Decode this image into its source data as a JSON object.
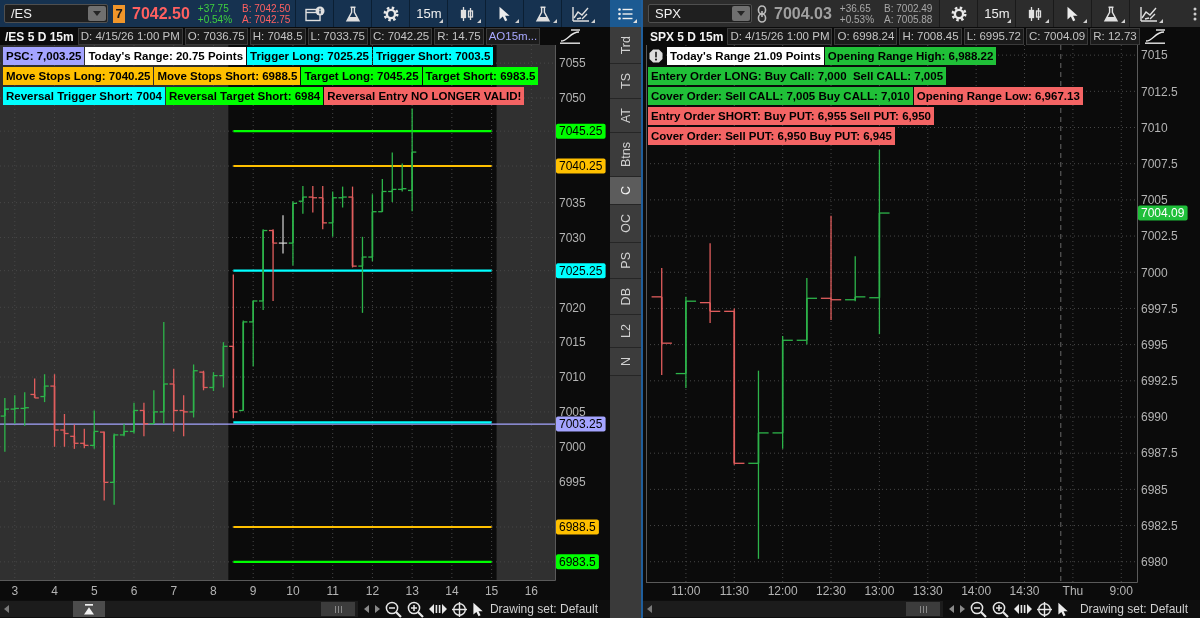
{
  "left_chart": {
    "active": true,
    "symbol": "/ES",
    "link_group": "7",
    "last_price": "7042.50",
    "live": true,
    "down_tick": true,
    "net_change": "+37.75",
    "percent_change": "+0.54%",
    "bid": "B: 7042.50",
    "ask": "A: 7042.75",
    "aggregation": "15m",
    "title": "/ES 5 D 15m",
    "info": [
      {
        "text": "D: 4/15/26 1:00 PM",
        "kind": "value"
      },
      {
        "text": "O: 7036.75",
        "kind": "value"
      },
      {
        "text": "H: 7048.5",
        "kind": "value"
      },
      {
        "text": "L: 7033.75",
        "kind": "value"
      },
      {
        "text": "C: 7042.25",
        "kind": "value"
      },
      {
        "text": "R: 14.75",
        "kind": "value"
      },
      {
        "text": "AO15m...",
        "kind": "study"
      }
    ],
    "label_rows": [
      [
        {
          "text": "PSC: 7,003.25",
          "color": "#a4a4ff"
        },
        {
          "text": "Today's Range: 20.75 Points",
          "color": "#ffffff"
        },
        {
          "text": "Trigger Long: 7025.25",
          "color": "#00ffff"
        },
        {
          "text": "Trigger Short: 7003.5",
          "color": "#00ffff"
        }
      ],
      [
        {
          "text": "Move Stops Long: 7040.25",
          "color": "#ffc000"
        },
        {
          "text": "Move Stops Short: 6988.5",
          "color": "#ffc000"
        },
        {
          "text": "Target Long: 7045.25",
          "color": "#00ff00"
        },
        {
          "text": "Target Short: 6983.5",
          "color": "#00ff00"
        }
      ],
      [
        {
          "text": "Reversal Trigger Short: 7004",
          "color": "#00ffff"
        },
        {
          "text": "Reversal Target Short: 6984",
          "color": "#00ff00"
        },
        {
          "text": "Reversal Entry NO LONGER VALID!",
          "color": "#f46464"
        }
      ]
    ],
    "chart_data": [
      {
        "type": "candlestick",
        "x": [
          2.75,
          3,
          3.25,
          3.5,
          3.75,
          4,
          4.25,
          4.5,
          4.75,
          5,
          5.25,
          5.5,
          5.75,
          6,
          6.25,
          6.5,
          6.75,
          7,
          7.25,
          7.5,
          7.75,
          8,
          8.25,
          8.5,
          8.75,
          9,
          9.25,
          9.5,
          9.75,
          10,
          10.25,
          10.5,
          10.75,
          11,
          11.25,
          11.5,
          11.75,
          12,
          12.25,
          12.5,
          12.75,
          13,
          13.25,
          13.5,
          13.75,
          14,
          14.25,
          14.5,
          14.75,
          15
        ],
        "ohlc": [
          [
            7004.4,
            7007,
            6999.3,
            7005.4
          ],
          [
            7005.4,
            7007.4,
            7003.3,
            7005.5
          ],
          [
            7005.5,
            7007.8,
            7003,
            7005.6
          ],
          [
            7007.5,
            7009.8,
            7007,
            7007
          ],
          [
            7007.2,
            7010.4,
            7006.4,
            7008.7
          ],
          [
            7008.7,
            7010.4,
            7000,
            7002.4
          ],
          [
            7002.4,
            7004.7,
            7000,
            7001.9
          ],
          [
            7001.5,
            7003.2,
            6999.7,
            7000.5
          ],
          [
            7000.5,
            7002.6,
            6999.8,
            7000.2
          ],
          [
            7000.2,
            7005.2,
            6999.7,
            7002.2
          ],
          [
            7002.1,
            7002.2,
            6992.3,
            6994.9
          ],
          [
            6994.9,
            7001.9,
            6991.7,
            7001.7
          ],
          [
            7001.7,
            7003.3,
            7001.5,
            7002.2
          ],
          [
            7002.2,
            7006.3,
            7001.9,
            7005.2
          ],
          [
            7005.2,
            7006.3,
            7001.5,
            7003.3
          ],
          [
            7003.3,
            7008.1,
            7003.3,
            7005
          ],
          [
            7005,
            7017.9,
            7003.3,
            7009
          ],
          [
            7009,
            7011.2,
            7002.2,
            7005.2
          ],
          [
            7005.2,
            7007.4,
            7001.5,
            7005
          ],
          [
            7005,
            7011.8,
            7004.2,
            7010.9
          ],
          [
            7010.7,
            7010.9,
            7008.1,
            7008.5
          ],
          [
            7008.5,
            7010.7,
            7008,
            7010.2
          ],
          [
            7010.2,
            7015,
            7008.5,
            7014.4
          ],
          [
            7014.4,
            7024.7,
            7004.1,
            7005
          ],
          [
            7005.2,
            7018.1,
            7005.2,
            7017.9
          ],
          [
            7017.9,
            7021,
            7011.5,
            7020.9
          ],
          [
            7020.9,
            7031.2,
            7019.6,
            7031
          ],
          [
            7031,
            7031.2,
            7020.9,
            7029.2
          ],
          [
            7029.2,
            7033.2,
            7027.7,
            7029.2
          ],
          [
            7029.2,
            7035.2,
            7026,
            7034.9
          ],
          [
            7035.2,
            7037.4,
            7033.4,
            7035.8
          ],
          [
            7035.8,
            7037.4,
            7033.6,
            7035.7
          ],
          [
            7035.7,
            7037.4,
            7031.2,
            7032.1
          ],
          [
            7032.1,
            7036.6,
            7030.1,
            7035.7
          ],
          [
            7035.7,
            7037.3,
            7034.3,
            7035.8
          ],
          [
            7035.8,
            7037.3,
            7025.7,
            7025.9
          ],
          [
            7025.9,
            7030.1,
            7019.2,
            7027.2
          ],
          [
            7027.2,
            7036.2,
            7026.6,
            7033.7
          ],
          [
            7033.7,
            7038.4,
            7033.7,
            7036.6
          ],
          [
            7036.6,
            7042.2,
            7035.1,
            7036.9
          ],
          [
            7036.9,
            7040.6,
            7036.6,
            7037
          ],
          [
            7036.75,
            7048.5,
            7033.75,
            7042.25
          ],
          null,
          null,
          null,
          null,
          null,
          null,
          null,
          null
        ],
        "series": [
          {
            "type": "line",
            "color": "#00ff00",
            "values": [
              null,
              null,
              null,
              null,
              null,
              null,
              null,
              null,
              null,
              null,
              null,
              null,
              null,
              null,
              null,
              null,
              null,
              null,
              null,
              null,
              null,
              null,
              null,
              7045.25,
              7045.25,
              7045.25,
              7045.25,
              7045.25,
              7045.25,
              7045.25,
              7045.25,
              7045.25,
              7045.25,
              7045.25,
              7045.25,
              7045.25,
              7045.25,
              7045.25,
              7045.25,
              7045.25,
              7045.25,
              7045.25,
              7045.25,
              7045.25,
              7045.25,
              7045.25,
              7045.25,
              7045.25,
              7045.25,
              7045.25
            ]
          },
          {
            "type": "line",
            "color": "#ffc000",
            "values": [
              null,
              null,
              null,
              null,
              null,
              null,
              null,
              null,
              null,
              null,
              null,
              null,
              null,
              null,
              null,
              null,
              null,
              null,
              null,
              null,
              null,
              null,
              null,
              7040.25,
              7040.25,
              7040.25,
              7040.25,
              7040.25,
              7040.25,
              7040.25,
              7040.25,
              7040.25,
              7040.25,
              7040.25,
              7040.25,
              7040.25,
              7040.25,
              7040.25,
              7040.25,
              7040.25,
              7040.25,
              7040.25,
              7040.25,
              7040.25,
              7040.25,
              7040.25,
              7040.25,
              7040.25,
              7040.25,
              7040.25
            ]
          },
          {
            "type": "line",
            "color": "#00ffff",
            "values": [
              null,
              null,
              null,
              null,
              null,
              null,
              null,
              null,
              null,
              null,
              null,
              null,
              null,
              null,
              null,
              null,
              null,
              null,
              null,
              null,
              null,
              null,
              null,
              7025.25,
              7025.25,
              7025.25,
              7025.25,
              7025.25,
              7025.25,
              7025.25,
              7025.25,
              7025.25,
              7025.25,
              7025.25,
              7025.25,
              7025.25,
              7025.25,
              7025.25,
              7025.25,
              7025.25,
              7025.25,
              7025.25,
              7025.25,
              7025.25,
              7025.25,
              7025.25,
              7025.25,
              7025.25,
              7025.25,
              7025.25
            ]
          },
          {
            "type": "line",
            "color": "#00ffff",
            "values": [
              null,
              null,
              null,
              null,
              null,
              null,
              null,
              null,
              null,
              null,
              null,
              null,
              null,
              null,
              null,
              null,
              null,
              null,
              null,
              null,
              null,
              null,
              null,
              7003.5,
              7003.5,
              7003.5,
              7003.5,
              7003.5,
              7003.5,
              7003.5,
              7003.5,
              7003.5,
              7003.5,
              7003.5,
              7003.5,
              7003.5,
              7003.5,
              7003.5,
              7003.5,
              7003.5,
              7003.5,
              7003.5,
              7003.5,
              7003.5,
              7003.5,
              7003.5,
              7003.5,
              7003.5,
              7003.5,
              7003.5
            ]
          },
          {
            "type": "line",
            "color": "#ffc000",
            "values": [
              null,
              null,
              null,
              null,
              null,
              null,
              null,
              null,
              null,
              null,
              null,
              null,
              null,
              null,
              null,
              null,
              null,
              null,
              null,
              null,
              null,
              null,
              null,
              6988.5,
              6988.5,
              6988.5,
              6988.5,
              6988.5,
              6988.5,
              6988.5,
              6988.5,
              6988.5,
              6988.5,
              6988.5,
              6988.5,
              6988.5,
              6988.5,
              6988.5,
              6988.5,
              6988.5,
              6988.5,
              6988.5,
              6988.5,
              6988.5,
              6988.5,
              6988.5,
              6988.5,
              6988.5,
              6988.5,
              6988.5
            ]
          },
          {
            "type": "line",
            "color": "#00ff00",
            "values": [
              null,
              null,
              null,
              null,
              null,
              null,
              null,
              null,
              null,
              null,
              null,
              null,
              null,
              null,
              null,
              null,
              null,
              null,
              null,
              null,
              null,
              null,
              null,
              6983.5,
              6983.5,
              6983.5,
              6983.5,
              6983.5,
              6983.5,
              6983.5,
              6983.5,
              6983.5,
              6983.5,
              6983.5,
              6983.5,
              6983.5,
              6983.5,
              6983.5,
              6983.5,
              6983.5,
              6983.5,
              6983.5,
              6983.5,
              6983.5,
              6983.5,
              6983.5,
              6983.5,
              6983.5,
              6983.5,
              6983.5
            ]
          }
        ],
        "xlim": [
          2.628,
          16.595
        ],
        "ylim": [
          6980.9,
          7057.6
        ],
        "xticks": [
          3,
          4,
          5,
          6,
          7,
          8,
          9,
          10,
          11,
          12,
          13,
          14,
          15,
          16
        ],
        "yticks": [
          {
            "value": 6983.5,
            "label": "6983.5"
          },
          {
            "value": 6988.5,
            "label": "6988.5"
          },
          6995,
          7000,
          7005,
          7010,
          7015,
          7020,
          {
            "value": 7025.25,
            "label": "7025.25"
          },
          7030,
          7035,
          {
            "value": 7040.25,
            "label": "7040.25"
          },
          {
            "value": 7045.25,
            "label": "7045.25"
          },
          7050,
          7055
        ],
        "grid": true,
        "bands": [
          {
            "axis": "x",
            "from": 2.628,
            "to": 8.375,
            "color": "#303030"
          },
          {
            "axis": "x",
            "from": 15.125,
            "to": 16.595,
            "color": "#303030"
          }
        ],
        "ref_lines": [
          {
            "axis": "y",
            "value": 7003.25,
            "label": "7003.25",
            "color": "#a4a4ff"
          }
        ]
      }
    ],
    "drawing_set": "Drawing set: Default"
  },
  "side_tabs": [
    {
      "label": "Trd",
      "selected": false
    },
    {
      "label": "TS",
      "selected": false
    },
    {
      "label": "AT",
      "selected": false
    },
    {
      "label": "Btns",
      "selected": false
    },
    {
      "label": "C",
      "selected": true
    },
    {
      "label": "OC",
      "selected": false
    },
    {
      "label": "PS",
      "selected": false
    },
    {
      "label": "DB",
      "selected": false
    },
    {
      "label": "L2",
      "selected": false
    },
    {
      "label": "N",
      "selected": false
    }
  ],
  "right_chart": {
    "active": false,
    "symbol": "SPX",
    "last_price": "7004.03",
    "live": false,
    "net_change": "+36.65",
    "percent_change": "+0.53%",
    "bid": "B: 7002.49",
    "ask": "A: 7005.88",
    "aggregation": "15m",
    "title": "SPX 5 D 15m",
    "info": [
      {
        "text": "D: 4/15/26 1:00 PM",
        "kind": "value"
      },
      {
        "text": "O: 6998.24",
        "kind": "value"
      },
      {
        "text": "H: 7008.45",
        "kind": "value"
      },
      {
        "text": "L: 6995.72",
        "kind": "value"
      },
      {
        "text": "C: 7004.09",
        "kind": "value"
      },
      {
        "text": "R: 12.73",
        "kind": "value"
      }
    ],
    "warning_icon": true,
    "label_rows": [
      [
        {
          "text": "Today's Range 21.09 Points",
          "color": "#ffffff"
        },
        {
          "text": "Opening Range High: 6,988.22",
          "color": "#20c038"
        }
      ],
      [
        {
          "text": "Entery Order LONG: Buy Call: 7,000  Sell CALL: 7,005",
          "color": "#20c038"
        }
      ],
      [
        {
          "text": "Cover Order: Sell CALL: 7,005 Buy CALL: 7,010",
          "color": "#20c038"
        },
        {
          "text": "Opening Range Low: 6,967.13",
          "color": "#f46464"
        }
      ],
      [
        {
          "text": "Entry Order SHORT: Buy PUT: 6,955 Sell PUT: 6,950",
          "color": "#f46464"
        }
      ],
      [
        {
          "text": "Cover Order: Sell PUT: 6,950 Buy PUT: 6,945",
          "color": "#f46464"
        }
      ]
    ],
    "price_bubble": {
      "text": "7004.09",
      "color": "#1fbf3a"
    },
    "chart_data": [
      {
        "type": "candlestick",
        "categories": [
          null,
          "11:00",
          null,
          "11:30",
          null,
          "12:00",
          null,
          "12:30",
          null,
          "13:00",
          null,
          "13:30",
          null,
          "14:00",
          null,
          "14:30",
          null,
          "Thu",
          null,
          "9:00"
        ],
        "ohlc": [
          [
            6998.3,
            7000.3,
            6992.9,
            6995.1
          ],
          [
            6993,
            6998.3,
            6992,
            6998
          ],
          [
            6997.9,
            7002,
            6996.5,
            6997.3
          ],
          [
            6997.3,
            6997.5,
            6986.7,
            6986.8
          ],
          [
            6986.8,
            6993.2,
            6980.2,
            6988.9
          ],
          [
            6988.9,
            6995.6,
            6987.8,
            6995.3
          ],
          [
            6995.3,
            6999.6,
            6995,
            6998.2
          ],
          [
            6998.2,
            7003.9,
            6996.7,
            6998.1
          ],
          [
            6998.1,
            7001.1,
            6998,
            6998.3
          ],
          [
            6998.24,
            7008.45,
            6995.72,
            7004.09
          ],
          null,
          null,
          null,
          null,
          null,
          null,
          null,
          null,
          null,
          null
        ],
        "ylim": [
          6978.6,
          7015.7
        ],
        "yticks": [
          6980,
          6982.5,
          6985,
          6987.5,
          6990,
          6992.5,
          6995,
          6997.5,
          7000,
          7002.5,
          7005,
          7007.5,
          7010,
          7012.5,
          7015
        ],
        "grid": true
      }
    ],
    "drawing_set": "Drawing set: Default"
  }
}
